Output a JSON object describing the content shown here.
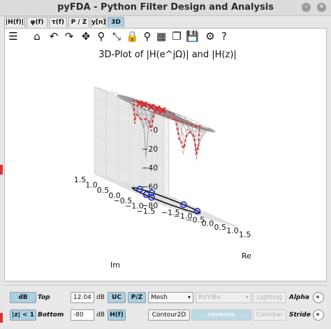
{
  "window": {
    "title": "pyFDA - Python Filter Design and Analysis"
  },
  "tabs": [
    {
      "label": "|H(f)|"
    },
    {
      "label": "φ(f)"
    },
    {
      "label": "τ(f)"
    },
    {
      "label": "P / Z"
    },
    {
      "label": "y[n]"
    },
    {
      "label": "3D"
    }
  ],
  "active_tab": "3D",
  "toolbar": {
    "icons": [
      "menu-icon",
      "home-icon",
      "undo-icon",
      "redo-icon",
      "pan-icon",
      "zoom-icon",
      "zoom-full-icon",
      "lock-icon",
      "marker-icon",
      "grid-icon",
      "copy-icon",
      "save-icon",
      "settings-icon",
      "help-icon"
    ],
    "glyphs": [
      "☰",
      "⌂",
      "↶",
      "↷",
      "✥",
      "⚲",
      "⤡",
      "🔒",
      "⚲",
      "▦",
      "❐",
      "💾",
      "⚙",
      "?"
    ]
  },
  "chart_data": {
    "type": "3d-surface",
    "title": "3D-Plot of |H(e^jΩ)| and |H(z)|",
    "xlabel": "Re",
    "ylabel": "Im",
    "zlabel": "",
    "xlim": [
      -1.5,
      1.5
    ],
    "ylim": [
      -1.5,
      1.5
    ],
    "zlim": [
      -80,
      12.04
    ],
    "x_ticks": [
      "−1.5",
      "−1.0",
      "−0.5",
      "0.0",
      "0.5",
      "1.0",
      "1.5"
    ],
    "y_ticks": [
      "−1.5",
      "−1.0",
      "−0.5",
      "0.0",
      "0.5",
      "1.0",
      "1.5"
    ],
    "z_ticks": [
      "0",
      "−20",
      "−40",
      "−60",
      "−80"
    ],
    "surface": "mesh",
    "unit_circle": true,
    "poles": [
      {
        "re": -0.5,
        "im": 0.62
      },
      {
        "re": -0.28,
        "im": 0.66
      },
      {
        "re": 0.0,
        "im": 0.65
      },
      {
        "re": 0.22,
        "im": 0.63
      },
      {
        "re": 0.43,
        "im": 0.62
      }
    ],
    "zeros": [
      {
        "re": -0.8,
        "im": 0.0
      },
      {
        "re": -0.15,
        "im": 0.98
      },
      {
        "re": 0.3,
        "im": 0.95
      },
      {
        "re": 0.96,
        "im": 0.28
      },
      {
        "re": 0.88,
        "im": -0.4
      },
      {
        "re": -0.92,
        "im": -0.35
      }
    ],
    "colors": {
      "pole": "#e41a1c",
      "zero": "#1f2fd6",
      "mesh": "#8a8a8a",
      "response": "#e04040"
    }
  },
  "controls": {
    "db": "dB",
    "top_label": "Top",
    "top_value": "12.04",
    "top_unit": "dB",
    "uc": "UC",
    "pz": "P/Z",
    "plot_type": "Mesh",
    "colormap": "RdYlBu",
    "lighting": "Lighting",
    "alpha_label": "Alpha",
    "zlim_mode": "|z| < 1",
    "bottom_label": "Bottom",
    "bottom_value": "-80",
    "bottom_unit": "dB",
    "hf": "H(f)",
    "contour": "Contour2D",
    "reverse": "reverse",
    "colorbar": "Colorbar",
    "stride_label": "Stride"
  }
}
